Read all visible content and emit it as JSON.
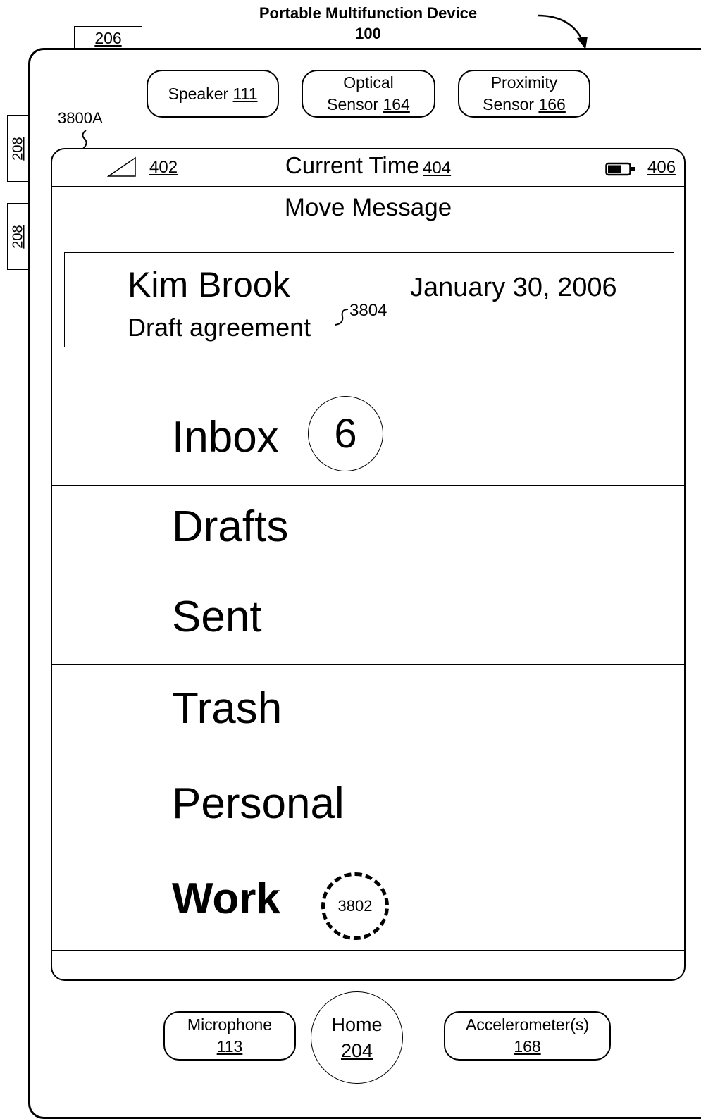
{
  "figure": {
    "title": "Portable Multifunction Device",
    "device_ref": "100",
    "top_button_ref": "206",
    "side_button_ref_1": "208",
    "side_button_ref_2": "208",
    "screen_ref": "3800A"
  },
  "sensors": {
    "speaker": {
      "label": "Speaker",
      "ref": "111"
    },
    "optical": {
      "label_line1": "Optical",
      "label_line2": "Sensor",
      "ref": "164"
    },
    "proximity": {
      "label_line1": "Proximity",
      "label_line2": "Sensor",
      "ref": "166"
    }
  },
  "status_bar": {
    "signal_ref": "402",
    "time_label": "Current Time",
    "time_ref": "404",
    "battery_ref": "406"
  },
  "screen": {
    "title": "Move Message",
    "message": {
      "sender": "Kim Brook",
      "date": "January 30, 2006",
      "subject": "Draft agreement",
      "ref": "3804"
    },
    "folders": [
      {
        "name": "Inbox",
        "badge": "6"
      },
      {
        "name": "Drafts"
      },
      {
        "name": "Sent"
      },
      {
        "name": "Trash"
      },
      {
        "name": "Personal"
      },
      {
        "name": "Work",
        "touch_ref": "3802"
      }
    ]
  },
  "bottom": {
    "microphone": {
      "label": "Microphone",
      "ref": "113"
    },
    "home": {
      "label": "Home",
      "ref": "204"
    },
    "accelerometer": {
      "label": "Accelerometer(s)",
      "ref": "168"
    }
  }
}
